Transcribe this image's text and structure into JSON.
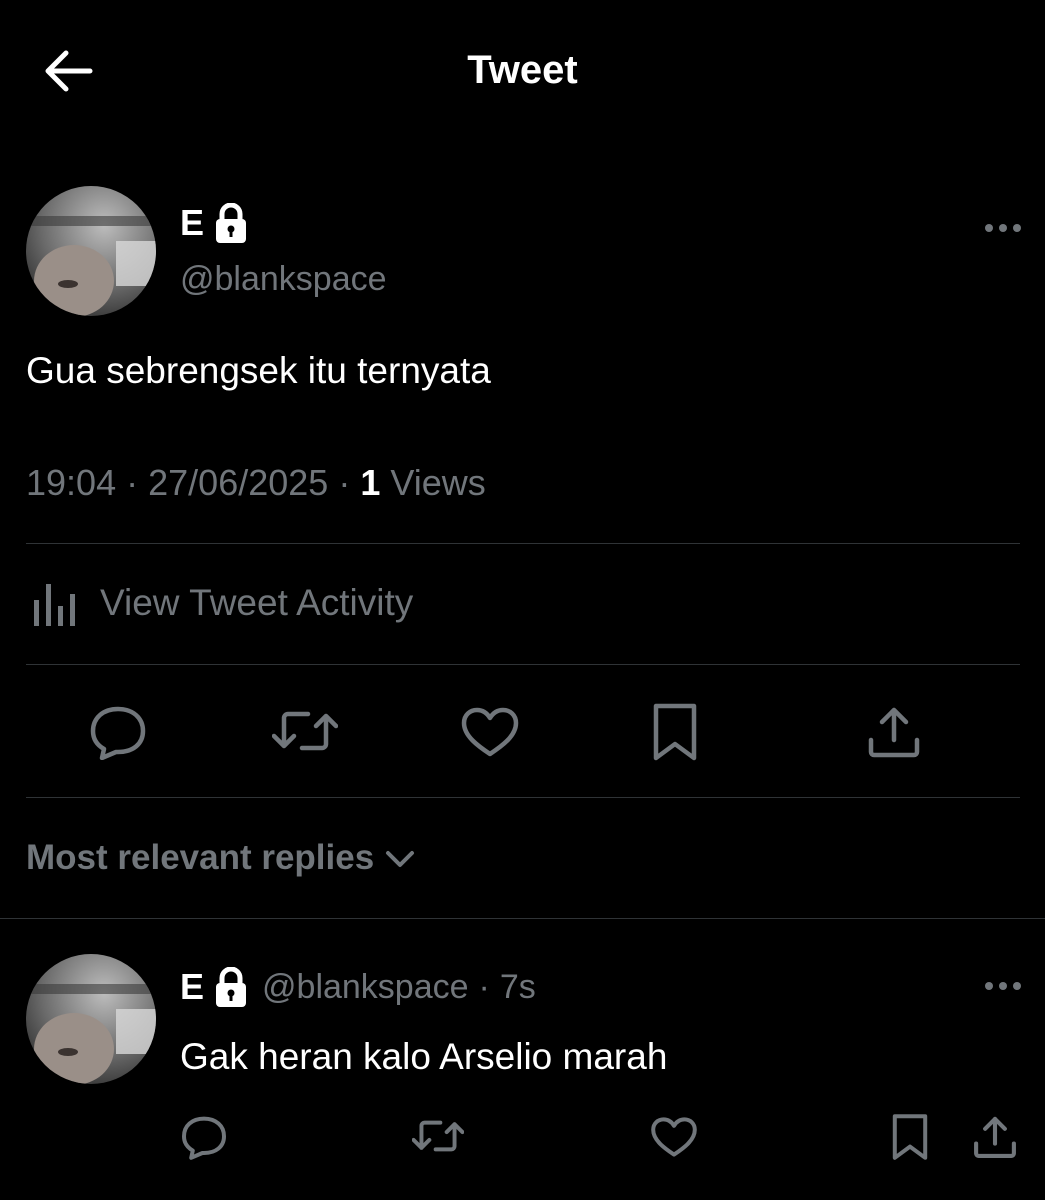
{
  "header": {
    "title": "Tweet",
    "back_icon": "arrow-left-icon"
  },
  "tweet": {
    "author": {
      "display_name": "E",
      "handle": "@blankspace",
      "locked": true
    },
    "text": "Gua sebrengsek itu ternyata",
    "time": "19:04",
    "date": "27/06/2025",
    "views_count": "1",
    "views_label": "Views",
    "separator": "·",
    "activity_label": "View Tweet Activity",
    "actions": [
      "reply-icon",
      "retweet-icon",
      "like-icon",
      "bookmark-icon",
      "share-icon"
    ]
  },
  "replies": {
    "sort_label": "Most relevant replies",
    "items": [
      {
        "display_name": "E",
        "handle": "@blankspace",
        "separator": "·",
        "age": "7s",
        "text": "Gak heran kalo Arselio marah"
      }
    ]
  },
  "colors": {
    "background": "#000000",
    "primary_text": "#e7e9ea",
    "secondary_text": "#71767b",
    "divider": "#2f3336"
  }
}
